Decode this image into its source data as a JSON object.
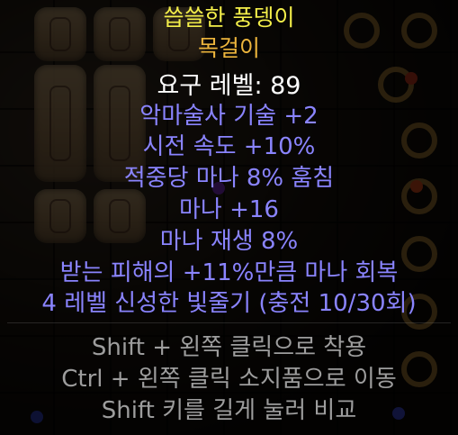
{
  "item": {
    "name": "씁쓸한 풍뎅이",
    "base_type": "목걸이",
    "requirement": "요구 레벨: 89",
    "name_color": "#f3ee4a",
    "base_color": "#ecb43c"
  },
  "modifiers": [
    "악마술사 기술 +2",
    "시전 속도 +10%",
    "적중당 마나 8% 훔침",
    "마나 +16",
    "마나 재생 8%",
    "받는 피해의 +11%만큼 마나 회복",
    "4 레벨 신성한 빛줄기 (충전 10/30회)"
  ],
  "modifier_color": "#8a84ff",
  "hints": [
    "Shift + 왼쪽 클릭으로 착용",
    "Ctrl + 왼쪽 클릭 소지품으로 이동",
    "Shift 키를 길게 눌러 비교"
  ],
  "hint_color": "#9d9d9d",
  "background": {
    "stash_items": [
      "talisman-tablet",
      "ring",
      "amulet"
    ]
  }
}
